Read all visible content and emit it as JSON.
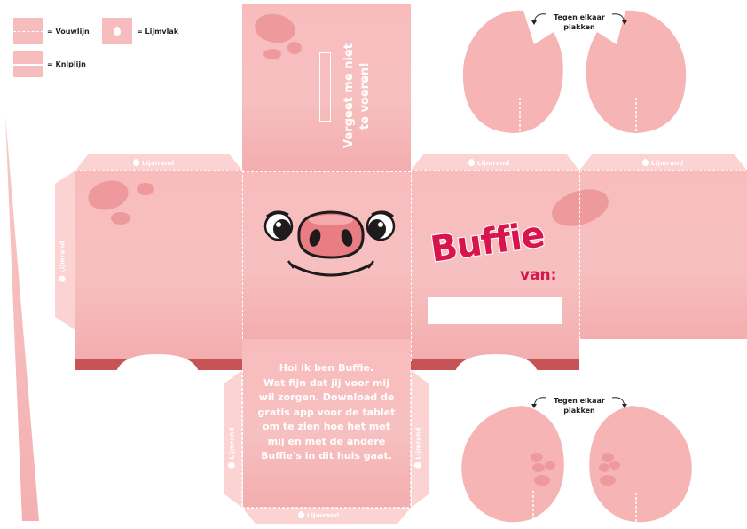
{
  "legend": {
    "fold_line": "= Vouwlijn",
    "glue_area": "= Lijmvlak",
    "cut_line": "= Kniplijn"
  },
  "glue_edge_label": "Lijmrand",
  "ears": {
    "top_label_line1": "Tegen elkaar",
    "top_label_line2": "plakken",
    "bottom_label_line1": "Tegen elkaar",
    "bottom_label_line2": "plakken"
  },
  "top_panel": {
    "reminder_line1": "Vergeet me niet",
    "reminder_line2": "te voeren!"
  },
  "name_panel": {
    "brand": "Buffie",
    "from": "van:"
  },
  "story_panel": {
    "lines": [
      "Hoi ik ben Buffie.",
      "Wat fijn dat jij voor mij",
      "wil zorgen.  Download de",
      "gratis app voor de tablet",
      "om te zien hoe het met",
      "mij en met de andere",
      "Buffie's in dit huis gaat."
    ]
  },
  "colors": {
    "body_pink": "#f7bcbd",
    "spot_pink": "#ee9a9d",
    "brand_red": "#d8144e",
    "base_red": "#c65356",
    "snout_pink": "#e97d84",
    "dark": "#1f1a1c"
  },
  "icons": [
    "drop-icon",
    "curved-arrow-icon"
  ]
}
